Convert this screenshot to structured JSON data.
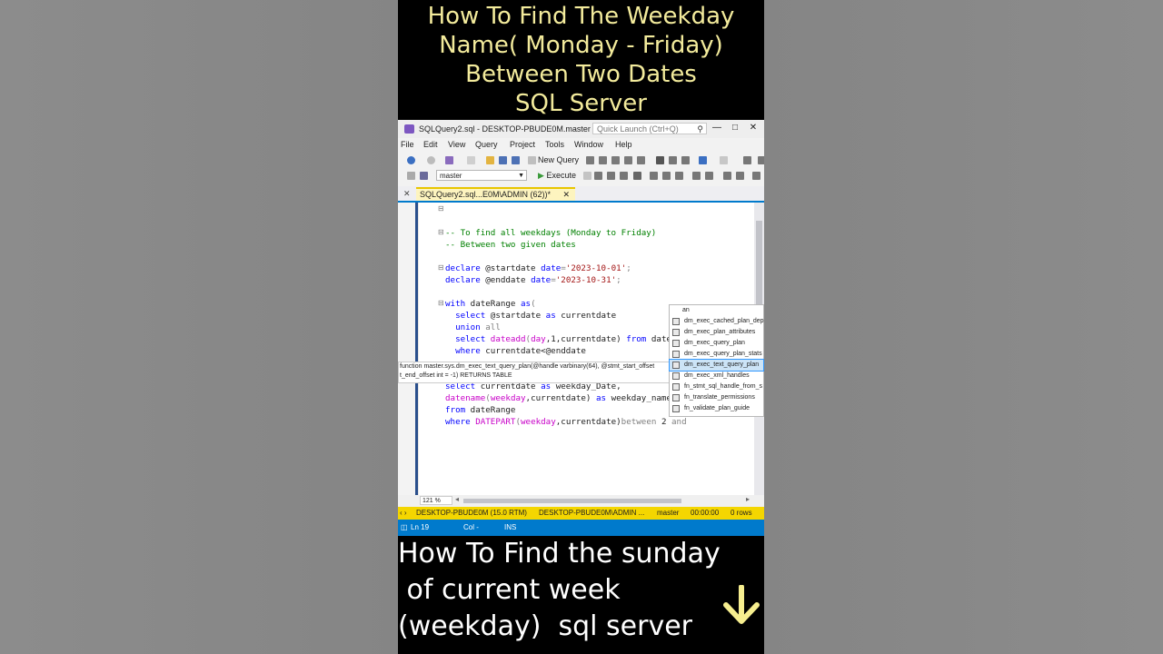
{
  "overlay": {
    "title_lines": [
      "How To Find The Weekday",
      "Name( Monday - Friday)",
      "Between Two Dates",
      "SQL Server"
    ],
    "bottom_lines": [
      "How To Find the sunday",
      " of current week",
      "(weekday)  sql server"
    ],
    "accent_color": "#f3eb9c",
    "arrow_icon": "down-arrow-icon"
  },
  "window": {
    "title": "SQLQuery2.sql - DESKTOP-PBUDE0M.master (...",
    "quick_launch_placeholder": "Quick Launch (Ctrl+Q)",
    "pin_glyph": "⊼",
    "minimize_glyph": "—",
    "maximize_glyph": "□",
    "close_glyph": "✕"
  },
  "menu": [
    "File",
    "Edit",
    "View",
    "Query",
    "Project",
    "Tools",
    "Window",
    "Help"
  ],
  "toolbar": {
    "new_query_label": "New Query",
    "database": "master",
    "execute_label": "Execute"
  },
  "tab": {
    "label": "SQLQuery2.sql...E0M\\ADMIN (62))*",
    "pin": "⊼",
    "close": "✕"
  },
  "code": {
    "l1": "-- To find all weekdays (Monday to Friday)",
    "l2": "-- Between two given dates",
    "l4a": "declare ",
    "l4b": "@startdate ",
    "l4c": "date",
    "l4d": "=",
    "l4e": "'2023-10-01'",
    "l4f": ";",
    "l5a": "declare ",
    "l5b": "@enddate ",
    "l5c": "date",
    "l5d": "=",
    "l5e": "'2023-10-31'",
    "l5f": ";",
    "l7a": "with ",
    "l7b": "dateRange ",
    "l7c": "as",
    "l7d": "(",
    "l8a": "  select ",
    "l8b": "@startdate ",
    "l8c": "as ",
    "l8d": "currentdate",
    "l9a": "  union ",
    "l9b": "all",
    "l10a": "  select ",
    "l10b": "dateadd",
    "l10c": "(",
    "l10d": "day",
    "l10e": ",1,currentdate) ",
    "l10f": "from ",
    "l10g": "date",
    "l11a": "  where ",
    "l11b": "currentdate<@enddate",
    "l14a": "select ",
    "l14b": "currentdate ",
    "l14c": "as ",
    "l14d": "weekday_Date,",
    "l15a": "datename",
    "l15b": "(",
    "l15c": "weekday",
    "l15d": ",currentdate) ",
    "l15e": "as ",
    "l15f": "weekday_name",
    "l16a": "from ",
    "l16b": "dateRange",
    "l17a": "where ",
    "l17b": "DATEPART",
    "l17c": "(",
    "l17d": "weekday",
    "l17e": ",currentdate)",
    "l17f": "between ",
    "l17g": "2 ",
    "l17h": "and"
  },
  "tooltip": {
    "line1": "function master.sys.dm_exec_text_query_plan(@handle varbinary(64), @stmt_start_offset",
    "line2": "t_end_offset int = -1) RETURNS TABLE"
  },
  "intellisense": {
    "items": [
      "an",
      "dm_exec_cached_plan_dep",
      "dm_exec_plan_attributes",
      "dm_exec_query_plan",
      "dm_exec_query_plan_stats",
      "dm_exec_text_query_plan",
      "dm_exec_xml_handles",
      "fn_stmt_sql_handle_from_s",
      "fn_translate_permissions",
      "fn_validate_plan_guide"
    ],
    "selected_index": 5
  },
  "editor": {
    "zoom": "121 %"
  },
  "status": {
    "server": "DESKTOP-PBUDE0M (15.0 RTM)",
    "user": "DESKTOP-PBUDE0M\\ADMIN ...",
    "db": "master",
    "time": "00:00:00",
    "rows": "0 rows",
    "ln": "Ln 19",
    "col": "Col -",
    "ins": "INS"
  }
}
